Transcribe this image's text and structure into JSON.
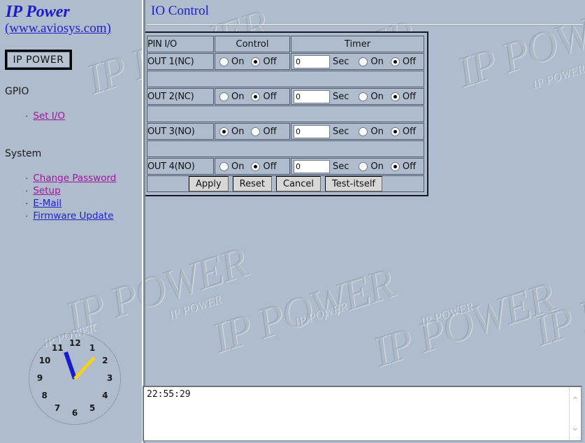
{
  "sidebar": {
    "brand_title": "IP Power",
    "brand_url": "(www.aviosys.com)",
    "logo_label": "IP POWER",
    "gpio_title": "GPIO",
    "gpio_items": [
      {
        "label": "Set I/O",
        "state": "visited"
      }
    ],
    "system_title": "System",
    "system_items": [
      {
        "label": "Change Password",
        "state": "visited"
      },
      {
        "label": "Setup",
        "state": "visited"
      },
      {
        "label": "E-Mail",
        "state": "normal"
      },
      {
        "label": "Firmware Update",
        "state": "normal"
      }
    ],
    "bullet": "·"
  },
  "clock": {
    "numbers": [
      "12",
      "1",
      "2",
      "3",
      "4",
      "5",
      "6",
      "7",
      "8",
      "9",
      "10",
      "11"
    ],
    "hour_hand_color": "#1a1ad0",
    "minute_hand_color": "#f5d020",
    "time": "22:55:29"
  },
  "main": {
    "heading": "IO Control"
  },
  "io_table": {
    "headers": [
      "PIN I/O",
      "Control",
      "Timer"
    ],
    "rows": [
      {
        "pin": "OUT 1(NC)",
        "control": {
          "on_label": "On",
          "off_label": "Off",
          "selected": "off"
        },
        "timer": {
          "value": "0",
          "unit": "Sec",
          "on_label": "On",
          "off_label": "Off",
          "selected": "off"
        }
      },
      {
        "pin": "OUT 2(NC)",
        "control": {
          "on_label": "On",
          "off_label": "Off",
          "selected": "off"
        },
        "timer": {
          "value": "0",
          "unit": "Sec",
          "on_label": "On",
          "off_label": "Off",
          "selected": "off"
        }
      },
      {
        "pin": "OUT 3(NO)",
        "control": {
          "on_label": "On",
          "off_label": "Off",
          "selected": "on"
        },
        "timer": {
          "value": "0",
          "unit": "Sec",
          "on_label": "On",
          "off_label": "Off",
          "selected": "off"
        }
      },
      {
        "pin": "OUT 4(NO)",
        "control": {
          "on_label": "On",
          "off_label": "Off",
          "selected": "off"
        },
        "timer": {
          "value": "0",
          "unit": "Sec",
          "on_label": "On",
          "off_label": "Off",
          "selected": "off"
        }
      }
    ],
    "buttons": [
      "Apply",
      "Reset",
      "Cancel",
      "Test-itself"
    ]
  },
  "log": {
    "content": "22:55:29",
    "scroll_up_icon": "⌃",
    "scroll_down_icon": "⌄"
  },
  "watermark": {
    "text": "IP POWER"
  },
  "colors": {
    "background": "#aebccd",
    "link": "#2222cc",
    "visited_link": "#a0159a",
    "heading": "#2121cc",
    "border_dark": "#151a25"
  }
}
